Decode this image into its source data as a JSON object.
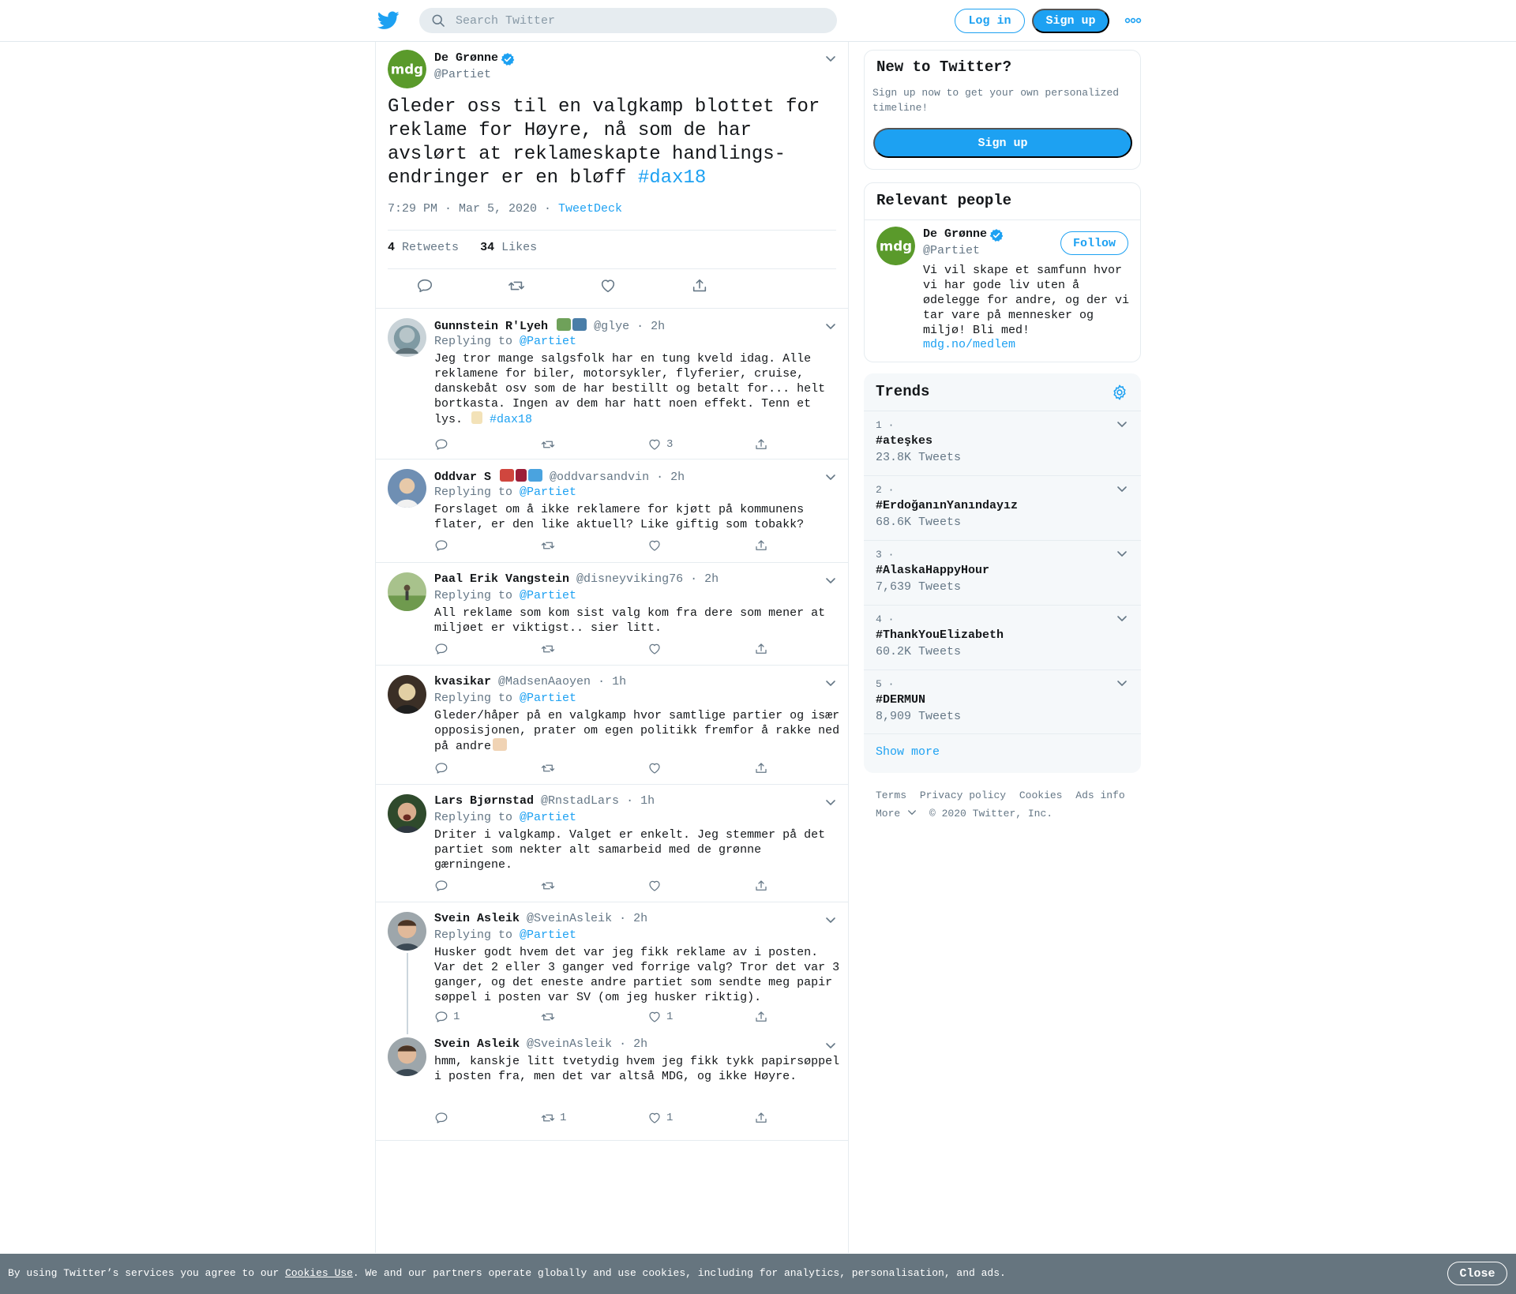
{
  "header": {
    "search_placeholder": "Search Twitter",
    "login_label": "Log in",
    "signup_label": "Sign up"
  },
  "focal_tweet": {
    "name": "De Grønne",
    "handle": "@Partiet",
    "text": "Gleder oss til en valgkamp blottet for reklame for Høyre, nå som de har avslørt at reklameskapte handlings-endringer er en bløff ",
    "hashtag": "#dax18",
    "time": "7:29 PM · Mar 5, 2020 · ",
    "source": "TweetDeck",
    "retweets_count": "4",
    "retweets_label": "Retweets",
    "likes_count": "34",
    "likes_label": "Likes"
  },
  "replies": [
    {
      "name": "Gunnstein R'Lyeh",
      "handle": "@glye",
      "time": " · 2h",
      "replying_to": "Replying to ",
      "mention": "@Partiet",
      "text": "Jeg tror mange salgsfolk har en tung kveld idag. Alle reklamene for biler, motorsykler, flyferier, cruise, danskebåt osv som de har bestillt og betalt for... helt bortkasta. Ingen av dem har hatt noen effekt. Tenn et lys. ",
      "hashtag": "#dax18",
      "replies": "",
      "retweets": "",
      "likes": "3"
    },
    {
      "name": "Oddvar S",
      "handle": "@oddvarsandvin",
      "time": " · 2h",
      "replying_to": "Replying to ",
      "mention": "@Partiet",
      "text": "Forslaget om å ikke reklamere for kjøtt på kommunens flater, er den like aktuell? Like giftig som tobakk?",
      "replies": "",
      "retweets": "",
      "likes": ""
    },
    {
      "name": "Paal Erik Vangstein",
      "handle": "@disneyviking76",
      "time": " · 2h",
      "replying_to": "Replying to ",
      "mention": "@Partiet",
      "text": "All reklame som kom sist  valg kom fra dere som mener at miljøet er viktigst..  sier litt.",
      "replies": "",
      "retweets": "",
      "likes": ""
    },
    {
      "name": "kvasikar",
      "handle": "@MadsenAaoyen",
      "time": " · 1h",
      "replying_to": "Replying to ",
      "mention": "@Partiet",
      "text": "Gleder/håper på en valgkamp hvor samtlige partier og især opposisjonen, prater om egen politikk fremfor å rakke ned på andre",
      "replies": "",
      "retweets": "",
      "likes": ""
    },
    {
      "name": "Lars Bjørnstad",
      "handle": "@RnstadLars",
      "time": " · 1h",
      "replying_to": "Replying to ",
      "mention": "@Partiet",
      "text": "Driter i valgkamp. Valget er enkelt. Jeg stemmer på det partiet som nekter alt samarbeid med de grønne gærningene.",
      "replies": "",
      "retweets": "",
      "likes": ""
    },
    {
      "name": "Svein Asleik",
      "handle": "@SveinAsleik",
      "time": " · 2h",
      "replying_to": "Replying to ",
      "mention": "@Partiet",
      "text": "Husker godt hvem det var jeg fikk reklame av i posten. Var det 2 eller 3 ganger ved forrige valg? Tror det var 3 ganger, og det eneste andre partiet som sendte meg papir søppel i posten var SV (om jeg husker riktig).",
      "replies": "1",
      "retweets": "",
      "likes": "1"
    },
    {
      "name": "Svein Asleik",
      "handle": "@SveinAsleik",
      "time": " · 2h",
      "text": "hmm, kanskje litt tvetydig hvem jeg fikk tykk papirsøppel i posten fra, men det var altså MDG, og ikke Høyre.",
      "replies": "",
      "retweets": "1",
      "likes": "1"
    }
  ],
  "new_to_twitter": {
    "title": "New to Twitter?",
    "text": "Sign up now to get your own personalized timeline!",
    "button": "Sign up"
  },
  "relevant_people": {
    "title": "Relevant people",
    "name": "De Grønne",
    "handle": "@Partiet",
    "follow_label": "Follow",
    "bio": "Vi vil skape et samfunn hvor vi har gode liv uten å ødelegge for andre, og der vi tar vare på mennesker og miljø! Bli med!",
    "link": "mdg.no/medlem"
  },
  "trends": {
    "title": "Trends",
    "items": [
      {
        "rank": "1 ·",
        "tag": "#ateşkes",
        "count": "23.8K Tweets"
      },
      {
        "rank": "2 ·",
        "tag": "#ErdoğanınYanındayız",
        "count": "68.6K Tweets"
      },
      {
        "rank": "3 ·",
        "tag": "#AlaskaHappyHour",
        "count": "7,639 Tweets"
      },
      {
        "rank": "4 ·",
        "tag": "#ThankYouElizabeth",
        "count": "60.2K Tweets"
      },
      {
        "rank": "5 ·",
        "tag": "#DERMUN",
        "count": "8,909 Tweets"
      }
    ],
    "show_more": "Show more"
  },
  "footer": {
    "links": [
      "Terms",
      "Privacy policy",
      "Cookies",
      "Ads info"
    ],
    "more": "More",
    "copyright": "© 2020 Twitter, Inc."
  },
  "cookie_banner": {
    "text_before": "By using Twitter’s services you agree to our ",
    "link": "Cookies Use",
    "text_after": ". We and our partners operate globally and use cookies, including for analytics, personalisation, and ads.",
    "close_label": "Close"
  },
  "colors": {
    "accent": "#1da1f2",
    "secondary_text": "#657786",
    "mdg_green": "#5a9a2b",
    "banner": "#66757f"
  },
  "icons": [
    "twitter-bird-icon",
    "search-icon",
    "more-dots-icon",
    "verified-icon",
    "chevron-down-icon",
    "reply-icon",
    "retweet-icon",
    "like-icon",
    "share-icon",
    "gear-icon"
  ]
}
